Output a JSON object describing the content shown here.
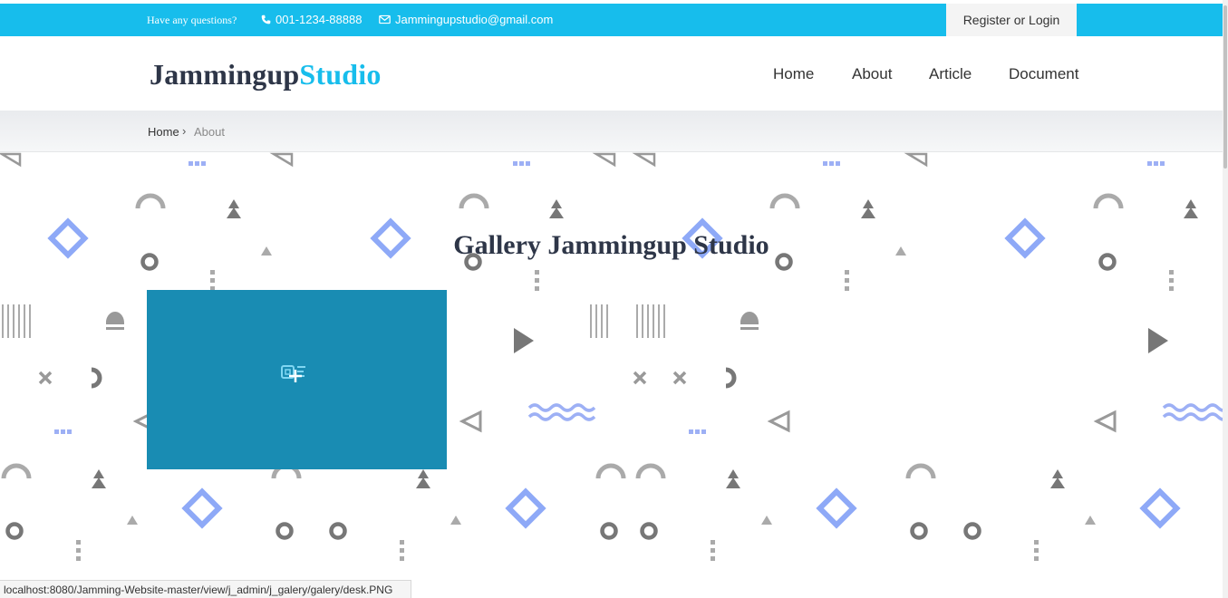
{
  "topbar": {
    "question": "Have any questions?",
    "phone": "001-1234-88888",
    "email": "Jammingupstudio@gmail.com",
    "login": "Register or Login",
    "accent": "#17bdec"
  },
  "header": {
    "logo_part1": "Jammingup",
    "logo_part2": "Studio",
    "nav": [
      "Home",
      "About",
      "Article",
      "Document"
    ]
  },
  "breadcrumb": {
    "home": "Home",
    "separator": "›",
    "current": "About"
  },
  "gallery": {
    "title": "Gallery Jammingup Studio",
    "thumb_color": "#198cb3",
    "thumb_icon": "code-logo-plus-icon"
  },
  "statusbar": {
    "url": "localhost:8080/Jamming-Website-master/view/j_admin/j_galery/galery/desk.PNG"
  }
}
